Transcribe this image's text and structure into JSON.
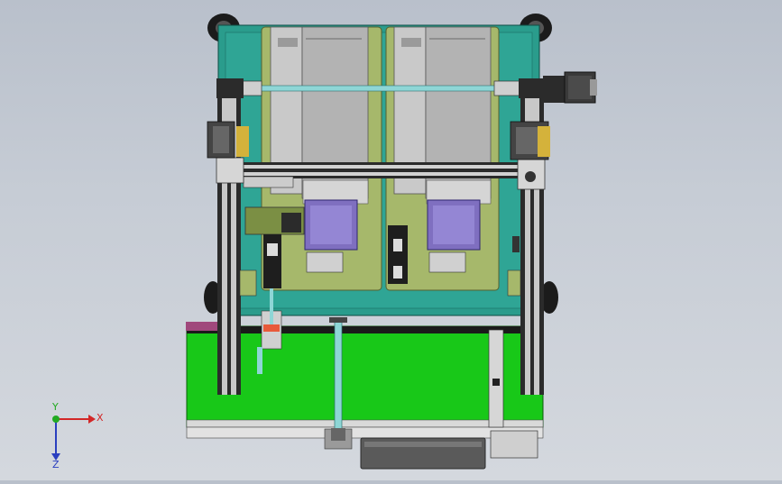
{
  "view": {
    "background_top": "#b9c0cb",
    "background_bottom": "#d4d8de"
  },
  "model_colors": {
    "frame_teal": "#2a9c8c",
    "plate_olive": "#a6b86b",
    "module_gray": "#b9b9b9",
    "module_dark": "#8f8f8f",
    "motor_purple": "#7f6fc0",
    "conveyor_green": "#18c818",
    "rail_dark": "#2b2b2b",
    "rail_silver": "#c8c8c8",
    "shaft_cyan": "#8ed6d6",
    "wheel_black": "#1b1b1b",
    "accent_magenta": "#a0487c"
  },
  "triad": {
    "x_label": "X",
    "y_label": "Y",
    "z_label": "Z",
    "x_color": "#d22727",
    "y_color": "#22aa22",
    "z_color": "#2a3fbf"
  }
}
